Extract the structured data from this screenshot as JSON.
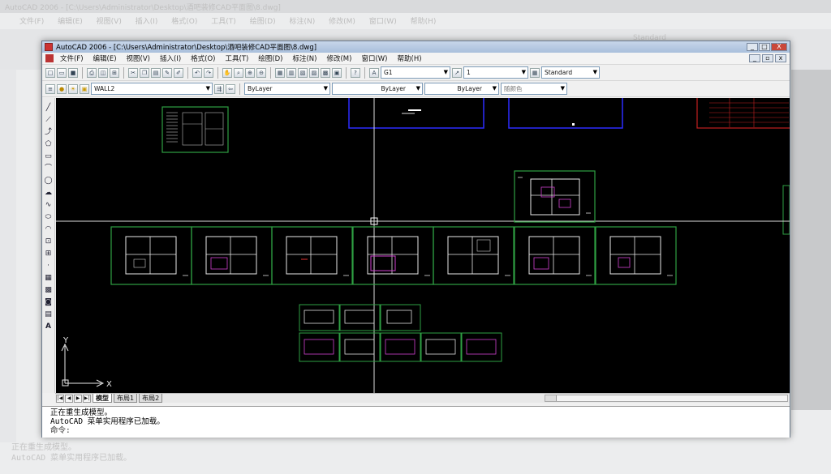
{
  "background_app": {
    "title": "AutoCAD 2006 - [C:\\Users\\Administrator\\Desktop\\酒吧装修CAD平面图\\8.dwg]",
    "menu": [
      "文件(F)",
      "编辑(E)",
      "视图(V)",
      "插入(I)",
      "格式(O)",
      "工具(T)",
      "绘图(D)",
      "标注(N)",
      "修改(M)",
      "窗口(W)",
      "帮助(H)"
    ],
    "toolbar_text": "Standard",
    "cmd_lines": [
      "正在重生成模型。",
      "AutoCAD 菜单实用程序已加载。"
    ]
  },
  "window": {
    "title": "AutoCAD 2006 - [C:\\Users\\Administrator\\Desktop\\酒吧装修CAD平面图\\8.dwg]",
    "minimize": "_",
    "maximize": "□",
    "close": "X"
  },
  "menu": {
    "items": [
      "文件(F)",
      "编辑(E)",
      "视图(V)",
      "插入(I)",
      "格式(O)",
      "工具(T)",
      "绘图(D)",
      "标注(N)",
      "修改(M)",
      "窗口(W)",
      "帮助(H)"
    ],
    "mdi_minimize": "_",
    "mdi_restore": "▫",
    "mdi_close": "x"
  },
  "toolbar1": {
    "text_style": "G1",
    "dim_style": "1",
    "table_style": "Standard"
  },
  "toolbar2": {
    "layer": "WALL2",
    "color": "ByLayer",
    "linetype": "ByLayer",
    "lineweight": "ByLayer",
    "plotstyle": "随颜色"
  },
  "tabs": {
    "model": "模型",
    "layout1": "布局1",
    "layout2": "布局2"
  },
  "ucs": {
    "x_label": "X",
    "y_label": "Y"
  },
  "command": {
    "lines": [
      "正在重生成模型。",
      "AutoCAD 菜单实用程序已加载。"
    ],
    "prompt": "命令:"
  },
  "colors": {
    "canvas": "#000000",
    "frame": "#2ea043",
    "wall": "#e8e8e8",
    "accent_magenta": "#d040d0",
    "crosshair": "#dcdcdc",
    "blue_frame": "#2c2cff",
    "red_frame": "#c02020"
  }
}
